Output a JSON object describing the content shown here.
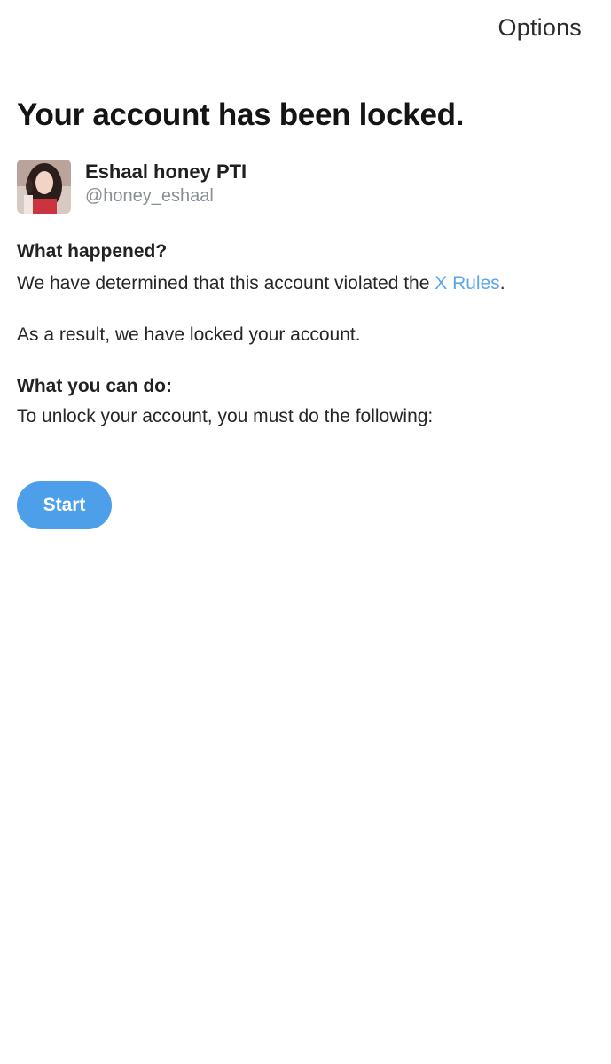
{
  "header": {
    "options_label": "Options"
  },
  "main": {
    "title": "Your account has been locked.",
    "profile": {
      "display_name": "Eshaal honey PTI",
      "handle": "@honey_eshaal"
    },
    "what_happened": {
      "heading": "What happened?",
      "text_before_link": "We have determined that this account violated the ",
      "link_label": "X Rules",
      "text_after_link": "."
    },
    "result_text": "As a result, we have locked your account.",
    "what_you_can_do": {
      "heading": "What you can do:",
      "text": "To unlock your account, you must do the following:"
    },
    "start_button_label": "Start"
  },
  "colors": {
    "accent": "#4e9fe9",
    "link": "#5ba7e6",
    "secondary_text": "#8a8f94"
  }
}
